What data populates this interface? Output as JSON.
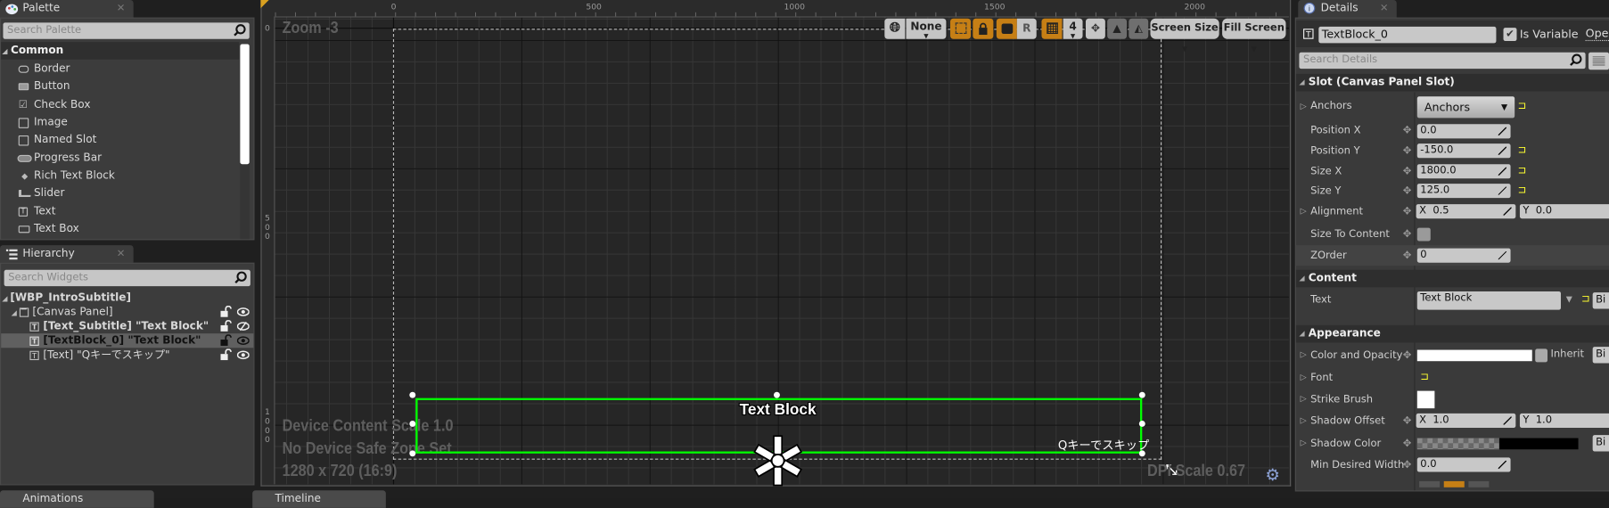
{
  "palette": {
    "tab_label": "Palette",
    "search_placeholder": "Search Palette",
    "category": "Common",
    "items": [
      "Border",
      "Button",
      "Check Box",
      "Image",
      "Named Slot",
      "Progress Bar",
      "Rich Text Block",
      "Slider",
      "Text",
      "Text Box"
    ]
  },
  "hierarchy": {
    "tab_label": "Hierarchy",
    "search_placeholder": "Search Widgets",
    "root": "[WBP_IntroSubtitle]",
    "canvas": "[Canvas Panel]",
    "children": [
      {
        "label": "[Text_Subtitle] \"Text Block\"",
        "bold": true,
        "hidden": true
      },
      {
        "label": "[TextBlock_0] \"Text Block\"",
        "bold": true,
        "selected": true
      },
      {
        "label": "[Text] \"Qキーでスキップ\"",
        "bold": false
      }
    ]
  },
  "bottom_tabs": [
    "Animations",
    "Timeline"
  ],
  "designer": {
    "zoom_label": "Zoom -3",
    "ruler_top": [
      "0",
      "500",
      "1000",
      "1500",
      "2000"
    ],
    "ruler_left": [
      "0",
      "500",
      "1000"
    ],
    "toolbar": {
      "localization": "None",
      "r_label": "R",
      "grid_snap": "4",
      "screen_size": "Screen Size",
      "fill_screen": "Fill Screen"
    },
    "device_info": [
      "Device Content Scale 1.0",
      "No Device Safe Zone Set",
      "1280 x 720 (16:9)"
    ],
    "dpi_scale": "DPI Scale 0.67",
    "widget_text": "Text Block",
    "skip_text": "Qキーでスキップ",
    "selection_color": "#00ff00",
    "accent_orange": "#c67f15"
  },
  "details": {
    "tab_label": "Details",
    "name_value": "TextBlock_0",
    "is_variable_label": "Is Variable",
    "is_variable": true,
    "open_label": "Open",
    "search_placeholder": "Search Details",
    "slot_section": "Slot (Canvas Panel Slot)",
    "anchors_label": "Anchors",
    "anchors_value": "Anchors",
    "position_x_label": "Position X",
    "position_x": "0.0",
    "position_y_label": "Position Y",
    "position_y": "-150.0",
    "size_x_label": "Size X",
    "size_x": "1800.0",
    "size_y_label": "Size Y",
    "size_y": "125.0",
    "alignment_label": "Alignment",
    "alignment_x": "X  0.5",
    "alignment_y": "Y  0.0",
    "size_to_content_label": "Size To Content",
    "size_to_content": false,
    "zorder_label": "ZOrder",
    "zorder": "0",
    "content_section": "Content",
    "text_label": "Text",
    "text_value": "Text Block",
    "bind_label": "Bi",
    "appearance_section": "Appearance",
    "color_label": "Color and Opacity",
    "inherit_label": "Inherit",
    "font_label": "Font",
    "strike_label": "Strike Brush",
    "shadow_offset_label": "Shadow Offset",
    "shadow_offset_x": "X  1.0",
    "shadow_offset_y": "Y  1.0",
    "shadow_color_label": "Shadow Color",
    "min_width_label": "Min Desired Width",
    "min_width": "0.0"
  }
}
